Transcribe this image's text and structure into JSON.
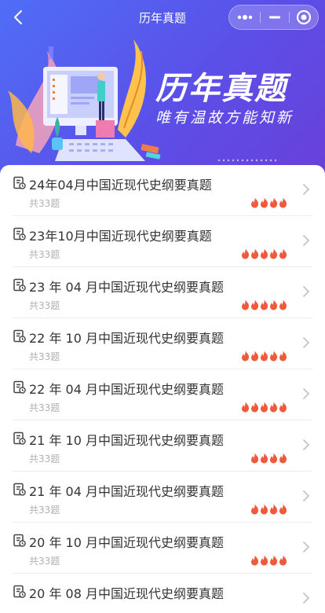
{
  "nav": {
    "title": "历年真题"
  },
  "banner": {
    "title": "历年真题",
    "subtitle": "唯有温故方能知新"
  },
  "items": [
    {
      "name": "24年04月中国近现代史纲要真题",
      "count": "共33题",
      "fires": 4
    },
    {
      "name": "23年10月中国近现代史纲要真题",
      "count": "共33题",
      "fires": 5
    },
    {
      "name": "23 年 04 月中国近现代史纲要真题",
      "count": "共33题",
      "fires": 5
    },
    {
      "name": "22 年 10 月中国近现代史纲要真题",
      "count": "共33题",
      "fires": 5
    },
    {
      "name": "22 年 04 月中国近现代史纲要真题",
      "count": "共33题",
      "fires": 5
    },
    {
      "name": "21 年 10 月中国近现代史纲要真题",
      "count": "共33题",
      "fires": 4
    },
    {
      "name": "21 年 04 月中国近现代史纲要真题",
      "count": "共33题",
      "fires": 4
    },
    {
      "name": "20 年 10 月中国近现代史纲要真题",
      "count": "共33题",
      "fires": 4
    },
    {
      "name": "20 年 08 月中国近现代史纲要真题",
      "count": "",
      "fires": 0
    }
  ],
  "colors": {
    "accent": "#5b5cf0",
    "fire": "#f05a3c"
  },
  "icons": {
    "back": "chevron-left-icon",
    "more": "more-dots-icon",
    "minimize": "minimize-icon",
    "close": "target-close-icon",
    "doc": "document-icon",
    "fire": "fire-icon",
    "chevron": "chevron-right-icon"
  }
}
